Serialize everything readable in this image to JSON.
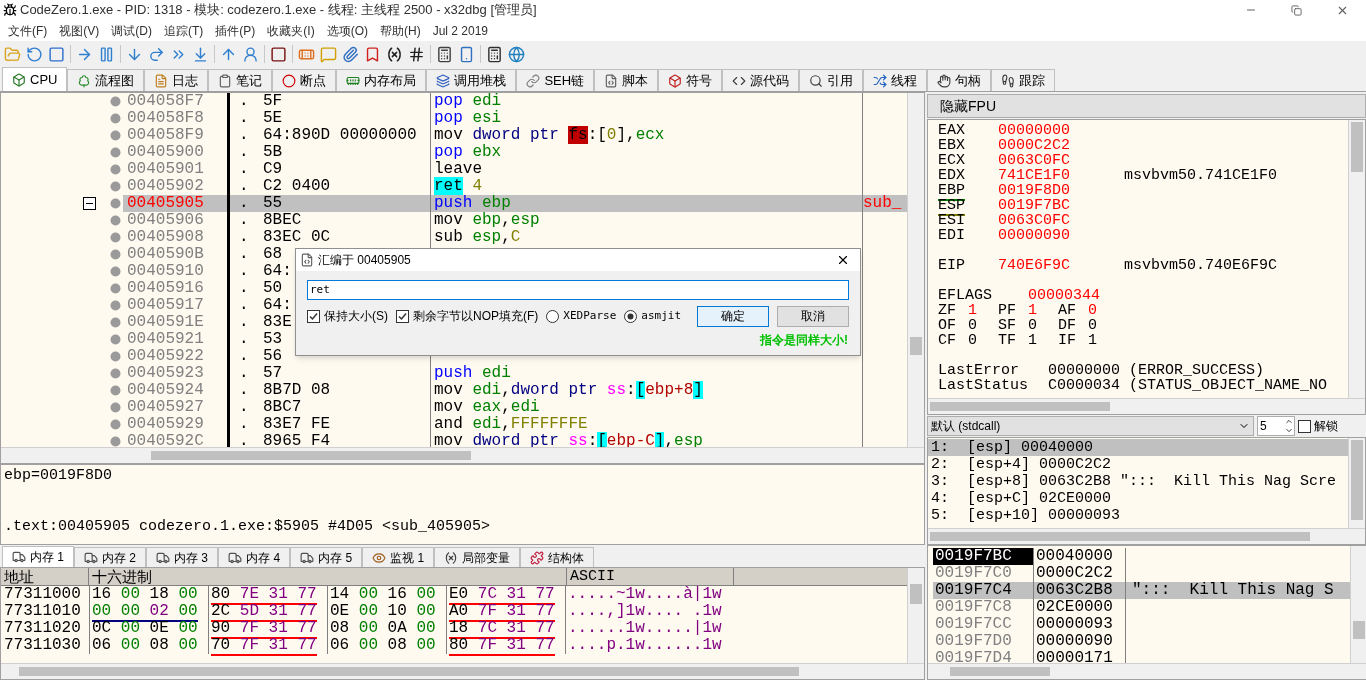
{
  "window": {
    "title": "CodeZero.1.exe - PID: 1318 - 模块: codezero.1.exe - 线程: 主线程 2500 - x32dbg [管理员]"
  },
  "menu": [
    "文件(F)",
    "视图(V)",
    "调试(D)",
    "追踪(T)",
    "插件(P)",
    "收藏夹(I)",
    "选项(O)",
    "帮助(H)",
    "Jul 2 2019"
  ],
  "tabs": [
    {
      "label": "CPU",
      "selected": true
    },
    {
      "label": "流程图",
      "selected": false
    },
    {
      "label": "日志",
      "selected": false
    },
    {
      "label": "笔记",
      "selected": false
    },
    {
      "label": "断点",
      "selected": false
    },
    {
      "label": "内存布局",
      "selected": false
    },
    {
      "label": "调用堆栈",
      "selected": false
    },
    {
      "label": "SEH链",
      "selected": false
    },
    {
      "label": "脚本",
      "selected": false
    },
    {
      "label": "符号",
      "selected": false
    },
    {
      "label": "源代码",
      "selected": false
    },
    {
      "label": "引用",
      "selected": false
    },
    {
      "label": "线程",
      "selected": false
    },
    {
      "label": "句柄",
      "selected": false
    },
    {
      "label": "跟踪",
      "selected": false
    }
  ],
  "disassembly": {
    "rows": [
      {
        "address": "004058F7",
        "dot": ".",
        "bytes": "5F",
        "tokens": [
          {
            "text": "pop ",
            "kind": "stack"
          },
          {
            "text": "edi",
            "kind": "reg"
          }
        ],
        "selected": false,
        "fold": false
      },
      {
        "address": "004058F8",
        "dot": ".",
        "bytes": "5E",
        "tokens": [
          {
            "text": "pop ",
            "kind": "stack"
          },
          {
            "text": "esi",
            "kind": "reg"
          }
        ],
        "selected": false,
        "fold": false
      },
      {
        "address": "004058F9",
        "dot": ".",
        "bytes": "64:890D 00000000",
        "tokens": [
          {
            "text": "mov ",
            "kind": "plain"
          },
          {
            "text": "dword ptr ",
            "kind": "size"
          },
          {
            "text": "fs",
            "kind": "segalert"
          },
          {
            "text": ":[",
            "kind": "plain"
          },
          {
            "text": "0",
            "kind": "num"
          },
          {
            "text": "],",
            "kind": "plain"
          },
          {
            "text": "ecx",
            "kind": "reg"
          }
        ],
        "selected": false,
        "fold": false
      },
      {
        "address": "00405900",
        "dot": ".",
        "bytes": "5B",
        "tokens": [
          {
            "text": "pop ",
            "kind": "stack"
          },
          {
            "text": "ebx",
            "kind": "reg"
          }
        ],
        "selected": false,
        "fold": false
      },
      {
        "address": "00405901",
        "dot": ".",
        "bytes": "C9",
        "tokens": [
          {
            "text": "leave",
            "kind": "plain"
          }
        ],
        "selected": false,
        "fold": false
      },
      {
        "address": "00405902",
        "dot": ".",
        "bytes": "C2 0400",
        "tokens": [
          {
            "text": "ret",
            "kind": "ret"
          },
          {
            "text": " 4",
            "kind": "num"
          }
        ],
        "selected": false,
        "fold": false
      },
      {
        "address": "00405905",
        "dot": ".",
        "bytes": "55",
        "tokens": [
          {
            "text": "push ",
            "kind": "stack"
          },
          {
            "text": "ebp",
            "kind": "reg"
          }
        ],
        "comment": "sub_",
        "selected": true,
        "fold": true
      },
      {
        "address": "00405906",
        "dot": ".",
        "bytes": "8BEC",
        "tokens": [
          {
            "text": "mov ",
            "kind": "plain"
          },
          {
            "text": "ebp",
            "kind": "reg"
          },
          {
            "text": ",",
            "kind": "plain"
          },
          {
            "text": "esp",
            "kind": "reg"
          }
        ],
        "selected": false,
        "fold": false
      },
      {
        "address": "00405908",
        "dot": ".",
        "bytes": "83EC 0C",
        "tokens": [
          {
            "text": "sub ",
            "kind": "plain"
          },
          {
            "text": "esp",
            "kind": "reg"
          },
          {
            "text": ",",
            "kind": "plain"
          },
          {
            "text": "C",
            "kind": "num"
          }
        ],
        "selected": false,
        "fold": false
      },
      {
        "address": "0040590B",
        "dot": ".",
        "bytes": "68",
        "selected": false,
        "fold": false
      },
      {
        "address": "00405910",
        "dot": ".",
        "bytes": "64:",
        "selected": false,
        "fold": false
      },
      {
        "address": "00405916",
        "dot": ".",
        "bytes": "50",
        "selected": false,
        "fold": false
      },
      {
        "address": "00405917",
        "dot": ".",
        "bytes": "64:",
        "selected": false,
        "fold": false
      },
      {
        "address": "0040591E",
        "dot": ".",
        "bytes": "83E",
        "selected": false,
        "fold": false
      },
      {
        "address": "00405921",
        "dot": ".",
        "bytes": "53",
        "selected": false,
        "fold": false
      },
      {
        "address": "00405922",
        "dot": ".",
        "bytes": "56",
        "selected": false,
        "fold": false
      },
      {
        "address": "00405923",
        "dot": ".",
        "bytes": "57",
        "tokens": [
          {
            "text": "push ",
            "kind": "stack"
          },
          {
            "text": "edi",
            "kind": "reg"
          }
        ],
        "selected": false,
        "fold": false
      },
      {
        "address": "00405924",
        "dot": ".",
        "bytes": "8B7D 08",
        "tokens": [
          {
            "text": "mov ",
            "kind": "plain"
          },
          {
            "text": "edi",
            "kind": "reg"
          },
          {
            "text": ",",
            "kind": "plain"
          },
          {
            "text": "dword ptr ",
            "kind": "size"
          },
          {
            "text": "ss",
            "kind": "seg"
          },
          {
            "text": ":",
            "kind": "plain"
          },
          {
            "text": "[",
            "kind": "bracket"
          },
          {
            "text": "ebp+8",
            "kind": "mem"
          },
          {
            "text": "]",
            "kind": "bracket"
          }
        ],
        "selected": false,
        "fold": false
      },
      {
        "address": "00405927",
        "dot": ".",
        "bytes": "8BC7",
        "tokens": [
          {
            "text": "mov ",
            "kind": "plain"
          },
          {
            "text": "eax",
            "kind": "reg"
          },
          {
            "text": ",",
            "kind": "plain"
          },
          {
            "text": "edi",
            "kind": "reg"
          }
        ],
        "selected": false,
        "fold": false
      },
      {
        "address": "00405929",
        "dot": ".",
        "bytes": "83E7 FE",
        "tokens": [
          {
            "text": "and ",
            "kind": "plain"
          },
          {
            "text": "edi",
            "kind": "reg"
          },
          {
            "text": ",",
            "kind": "plain"
          },
          {
            "text": "FFFFFFFE",
            "kind": "num"
          }
        ],
        "selected": false,
        "fold": false
      },
      {
        "address": "0040592C",
        "dot": ".",
        "bytes": "8965 F4",
        "tokens": [
          {
            "text": "mov ",
            "kind": "plain"
          },
          {
            "text": "dword ptr ",
            "kind": "size"
          },
          {
            "text": "ss",
            "kind": "seg"
          },
          {
            "text": ":",
            "kind": "plain"
          },
          {
            "text": "[",
            "kind": "bracket"
          },
          {
            "text": "ebp-C",
            "kind": "mem"
          },
          {
            "text": "]",
            "kind": "bracket"
          },
          {
            "text": ",",
            "kind": "plain"
          },
          {
            "text": "esp",
            "kind": "reg"
          }
        ],
        "selected": false,
        "fold": false
      }
    ]
  },
  "dialog": {
    "title": "汇编于 00405905",
    "value": "ret",
    "options": [
      {
        "label": "保持大小(S)",
        "kind": "checkbox",
        "checked": true
      },
      {
        "label": "剩余字节以NOP填充(F)",
        "kind": "checkbox",
        "checked": true
      },
      {
        "label": "XEDParse",
        "kind": "radio",
        "checked": false
      },
      {
        "label": "asmjit",
        "kind": "radio",
        "checked": true
      }
    ],
    "buttons": [
      {
        "label": "确定",
        "default": true
      },
      {
        "label": "取消",
        "default": false
      }
    ],
    "status": "指令是同样大小!"
  },
  "info": {
    "lines": [
      "ebp=0019F8D0",
      ".text:00405905 codezero.1.exe:$5905 #4D05 <sub_405905>"
    ]
  },
  "fpu_button": "隐藏FPU",
  "registers": [
    {
      "name": "EAX",
      "value": "00000000",
      "changed": true
    },
    {
      "name": "EBX",
      "value": "0000C2C2",
      "changed": true
    },
    {
      "name": "ECX",
      "value": "0063C0FC",
      "changed": true
    },
    {
      "name": "EDX",
      "value": "741CE1F0",
      "changed": true,
      "comment": "msvbvm50.741CE1F0"
    },
    {
      "name": "EBP",
      "value": "0019F8D0",
      "changed": true,
      "color": "#008000"
    },
    {
      "name": "ESP",
      "value": "0019F7BC",
      "changed": true,
      "color": "#808000"
    },
    {
      "name": "ESI",
      "value": "0063C0FC",
      "changed": true
    },
    {
      "name": "EDI",
      "value": "00000090",
      "changed": true
    }
  ],
  "eip": {
    "name": "EIP",
    "value": "740E6F9C",
    "changed": true,
    "comment": "msvbvm50.740E6F9C"
  },
  "eflags": {
    "name": "EFLAGS",
    "value": "00000344",
    "changed": true
  },
  "flags": [
    {
      "name": "ZF",
      "value": "1",
      "changed": true
    },
    {
      "name": "PF",
      "value": "1",
      "changed": true
    },
    {
      "name": "AF",
      "value": "0",
      "changed": true
    },
    {
      "name": "OF",
      "value": "0",
      "changed": false
    },
    {
      "name": "SF",
      "value": "0",
      "changed": false
    },
    {
      "name": "DF",
      "value": "0",
      "changed": false
    },
    {
      "name": "CF",
      "value": "0",
      "changed": false
    },
    {
      "name": "TF",
      "value": "1",
      "changed": false
    },
    {
      "name": "IF",
      "value": "1",
      "changed": false
    }
  ],
  "status_lines": [
    {
      "name": "LastError",
      "value": "00000000 (ERROR_SUCCESS)"
    },
    {
      "name": "LastStatus",
      "value": "C0000034 (STATUS_OBJECT_NAME_NO"
    }
  ],
  "call_convention": {
    "value": "默认 (stdcall)",
    "count": "5",
    "unlock": {
      "label": "解锁",
      "checked": false
    }
  },
  "arguments": [
    {
      "text": "1:  [esp] 00040000",
      "selected": true
    },
    {
      "text": "2:  [esp+4] 0000C2C2",
      "selected": false
    },
    {
      "text": "3:  [esp+8] 0063C2B8 \":::  Kill This Nag Scre",
      "selected": false
    },
    {
      "text": "4:  [esp+C] 02CE0000",
      "selected": false
    },
    {
      "text": "5:  [esp+10] 00000093",
      "selected": false
    }
  ],
  "memory_tabs": [
    {
      "label": "内存 1",
      "selected": true
    },
    {
      "label": "内存 2",
      "selected": false
    },
    {
      "label": "内存 3",
      "selected": false
    },
    {
      "label": "内存 4",
      "selected": false
    },
    {
      "label": "内存 5",
      "selected": false
    },
    {
      "label": "监视 1",
      "selected": false
    },
    {
      "label": "局部变量",
      "selected": false
    },
    {
      "label": "结构体",
      "selected": false
    }
  ],
  "dump": {
    "columns": [
      "地址",
      "十六进制",
      "ASCII"
    ],
    "rows": [
      {
        "address": "77311000",
        "groups": [
          {
            "bytes": [
              "16",
              "00",
              "18",
              "00"
            ]
          },
          {
            "bytes": [
              "80",
              "7E",
              "31",
              "77"
            ],
            "color": "#ff0000"
          },
          {
            "bytes": [
              "14",
              "00",
              "16",
              "00"
            ]
          },
          {
            "bytes": [
              "E0",
              "7C",
              "31",
              "77"
            ],
            "color": "#ff0000"
          }
        ],
        "ascii": ".....~1w....à|1w"
      },
      {
        "address": "77311010",
        "groups": [
          {
            "bytes": [
              "00",
              "00",
              "02",
              "00"
            ],
            "color": "#000080"
          },
          {
            "bytes": [
              "2C",
              "5D",
              "31",
              "77"
            ],
            "color": "#ff0000"
          },
          {
            "bytes": [
              "0E",
              "00",
              "10",
              "00"
            ]
          },
          {
            "bytes": [
              "A0",
              "7F",
              "31",
              "77"
            ],
            "color": "#ff0000"
          }
        ],
        "ascii": "....,]1w.... .1w"
      },
      {
        "address": "77311020",
        "groups": [
          {
            "bytes": [
              "0C",
              "00",
              "0E",
              "00"
            ]
          },
          {
            "bytes": [
              "90",
              "7F",
              "31",
              "77"
            ],
            "color": "#ff0000"
          },
          {
            "bytes": [
              "08",
              "00",
              "0A",
              "00"
            ]
          },
          {
            "bytes": [
              "18",
              "7C",
              "31",
              "77"
            ],
            "color": "#ff0000"
          }
        ],
        "ascii": "......1w.....|1w"
      },
      {
        "address": "77311030",
        "groups": [
          {
            "bytes": [
              "06",
              "00",
              "08",
              "00"
            ]
          },
          {
            "bytes": [
              "70",
              "7F",
              "31",
              "77"
            ],
            "color": "#ff0000"
          },
          {
            "bytes": [
              "06",
              "00",
              "08",
              "00"
            ]
          },
          {
            "bytes": [
              "80",
              "7F",
              "31",
              "77"
            ],
            "color": "#ff0000"
          }
        ],
        "ascii": "....p.1w......1w"
      }
    ]
  },
  "stack": [
    {
      "address": "0019F7BC",
      "value": "00040000",
      "selected": true,
      "highlighted": false
    },
    {
      "address": "0019F7C0",
      "value": "0000C2C2",
      "selected": false,
      "highlighted": false
    },
    {
      "address": "0019F7C4",
      "value": "0063C2B8",
      "comment": "\":::  Kill This Nag S",
      "selected": false,
      "highlighted": true
    },
    {
      "address": "0019F7C8",
      "value": "02CE0000",
      "selected": false,
      "highlighted": false
    },
    {
      "address": "0019F7CC",
      "value": "00000093",
      "selected": false,
      "highlighted": false
    },
    {
      "address": "0019F7D0",
      "value": "00000090",
      "selected": false,
      "highlighted": false
    },
    {
      "address": "0019F7D4",
      "value": "00000171",
      "selected": false,
      "highlighted": false
    }
  ]
}
